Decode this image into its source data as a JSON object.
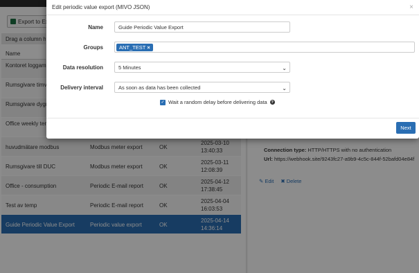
{
  "background": {
    "export_button_label": "Export to Excel",
    "drag_hint": "Drag a column header here to group by that column",
    "column_name_header": "Name",
    "rows": [
      {
        "name": "Kontoret loggamera REMOVE",
        "type": "",
        "status": "",
        "date": ""
      },
      {
        "name": "Rumsgivare timvärden",
        "type": "",
        "status": "",
        "date": ""
      },
      {
        "name": "Rumsgivare dygnsvärden",
        "type": "",
        "status": "",
        "date": ""
      },
      {
        "name": "Office weekly temperature",
        "type": "",
        "status": "",
        "date": ""
      },
      {
        "name": "huvudmätare modbus",
        "type": "Modbus meter export",
        "status": "OK",
        "date": "2025-03-10 13:40:33"
      },
      {
        "name": "Rumsgivare till DUC",
        "type": "Modbus meter export",
        "status": "OK",
        "date": "2025-03-11 12:08:39"
      },
      {
        "name": "Office - consumption",
        "type": "Periodic E-mail report",
        "status": "OK",
        "date": "2025-04-12 17:38:45"
      },
      {
        "name": "Test av temp",
        "type": "Periodic E-mail report",
        "status": "OK",
        "date": "2025-04-04 16:03:53"
      },
      {
        "name": "Guide Periodic Value Export",
        "type": "Periodic value export",
        "status": "OK",
        "date": "2025-04-14 14:36:14"
      }
    ],
    "details": {
      "connection_label": "Connection type:",
      "connection_value": "HTTP/HTTPS with no authentication",
      "url_label": "Url:",
      "url_value": "https://webhook.site/9243fc27-a9b9-4c5c-844f-52bafd04e84f",
      "edit_label": "Edit",
      "delete_label": "Delete"
    }
  },
  "modal": {
    "title": "Edit periodic value export (MIVO JSON)",
    "close_glyph": "×",
    "name_label": "Name",
    "name_value": "Guide Periodic Value Export",
    "groups_label": "Groups",
    "group_tag": "ANT_TEST",
    "resolution_label": "Data resolution",
    "resolution_value": "5 Minutes",
    "delivery_label": "Delivery interval",
    "delivery_value": "As soon as data has been collected",
    "random_delay_label": "Wait a random delay before delivering data",
    "random_delay_checked": true,
    "next_label": "Next"
  },
  "colors": {
    "accent": "#2a6eb3",
    "selected_row": "#2a6eb3"
  }
}
